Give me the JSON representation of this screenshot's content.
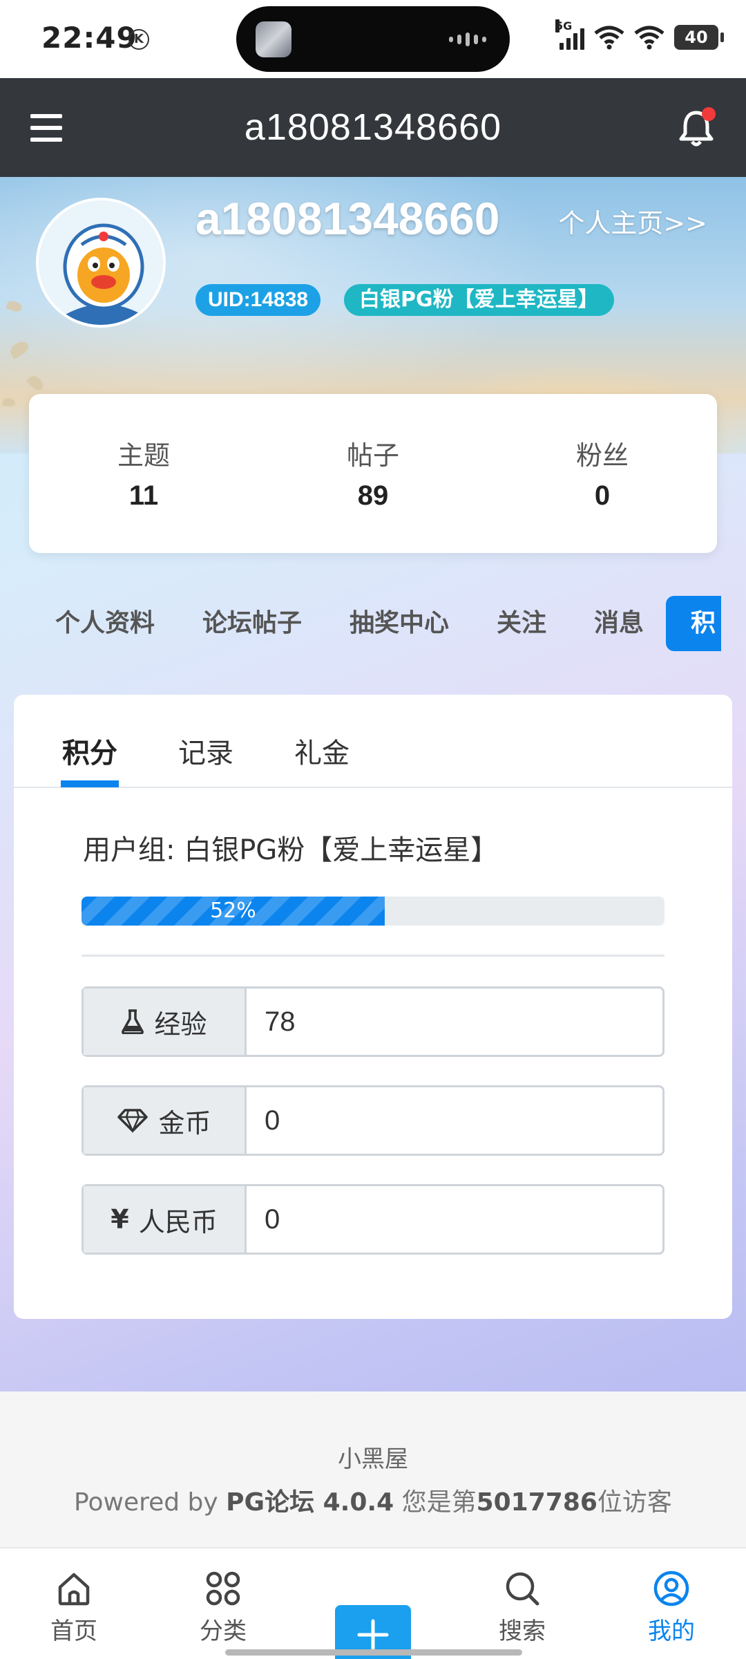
{
  "status_bar": {
    "time": "22:49",
    "badge": "K",
    "network": "5G",
    "battery": "40"
  },
  "header": {
    "title": "a18081348660"
  },
  "profile": {
    "name": "a18081348660",
    "homepage_link": "个人主页>>",
    "uid": "UID:14838",
    "group_badge": "白银PG粉【爱上幸运星】"
  },
  "stats": [
    {
      "label": "主题",
      "value": "11"
    },
    {
      "label": "帖子",
      "value": "89"
    },
    {
      "label": "粉丝",
      "value": "0"
    }
  ],
  "tab_strip": [
    "个人资料",
    "论坛帖子",
    "抽奖中心",
    "关注",
    "消息",
    "积"
  ],
  "inner_tabs": [
    "积分",
    "记录",
    "礼金"
  ],
  "points": {
    "usergroup": "用户组: 白银PG粉【爱上幸运星】",
    "progress_percent": 52,
    "progress_label": "52%",
    "fields": [
      {
        "icon": "flask-icon",
        "label": "经验",
        "value": "78"
      },
      {
        "icon": "diamond-icon",
        "label": "金币",
        "value": "0"
      },
      {
        "icon": "yen-icon",
        "glyph": "¥",
        "label": "人民币",
        "value": "0"
      }
    ]
  },
  "footer": {
    "site_name": "小黑屋",
    "powered_prefix": "Powered by ",
    "powered_brand": "PG论坛 4.0.4",
    "visitor_prefix": " 您是第",
    "visitor_count": "5017786",
    "visitor_suffix": "位访客"
  },
  "bottom_nav": [
    {
      "icon": "home-icon",
      "label": "首页"
    },
    {
      "icon": "grid-icon",
      "label": "分类"
    },
    {
      "icon": "plus-icon",
      "label": ""
    },
    {
      "icon": "search-icon",
      "label": "搜索"
    },
    {
      "icon": "user-circle-icon",
      "label": "我的"
    }
  ],
  "colors": {
    "accent": "#0b84ee",
    "header_bg": "#34373c",
    "uid_badge": "#1da1e6",
    "group_badge": "#1fb7c4",
    "notification_dot": "#f23a3a"
  }
}
